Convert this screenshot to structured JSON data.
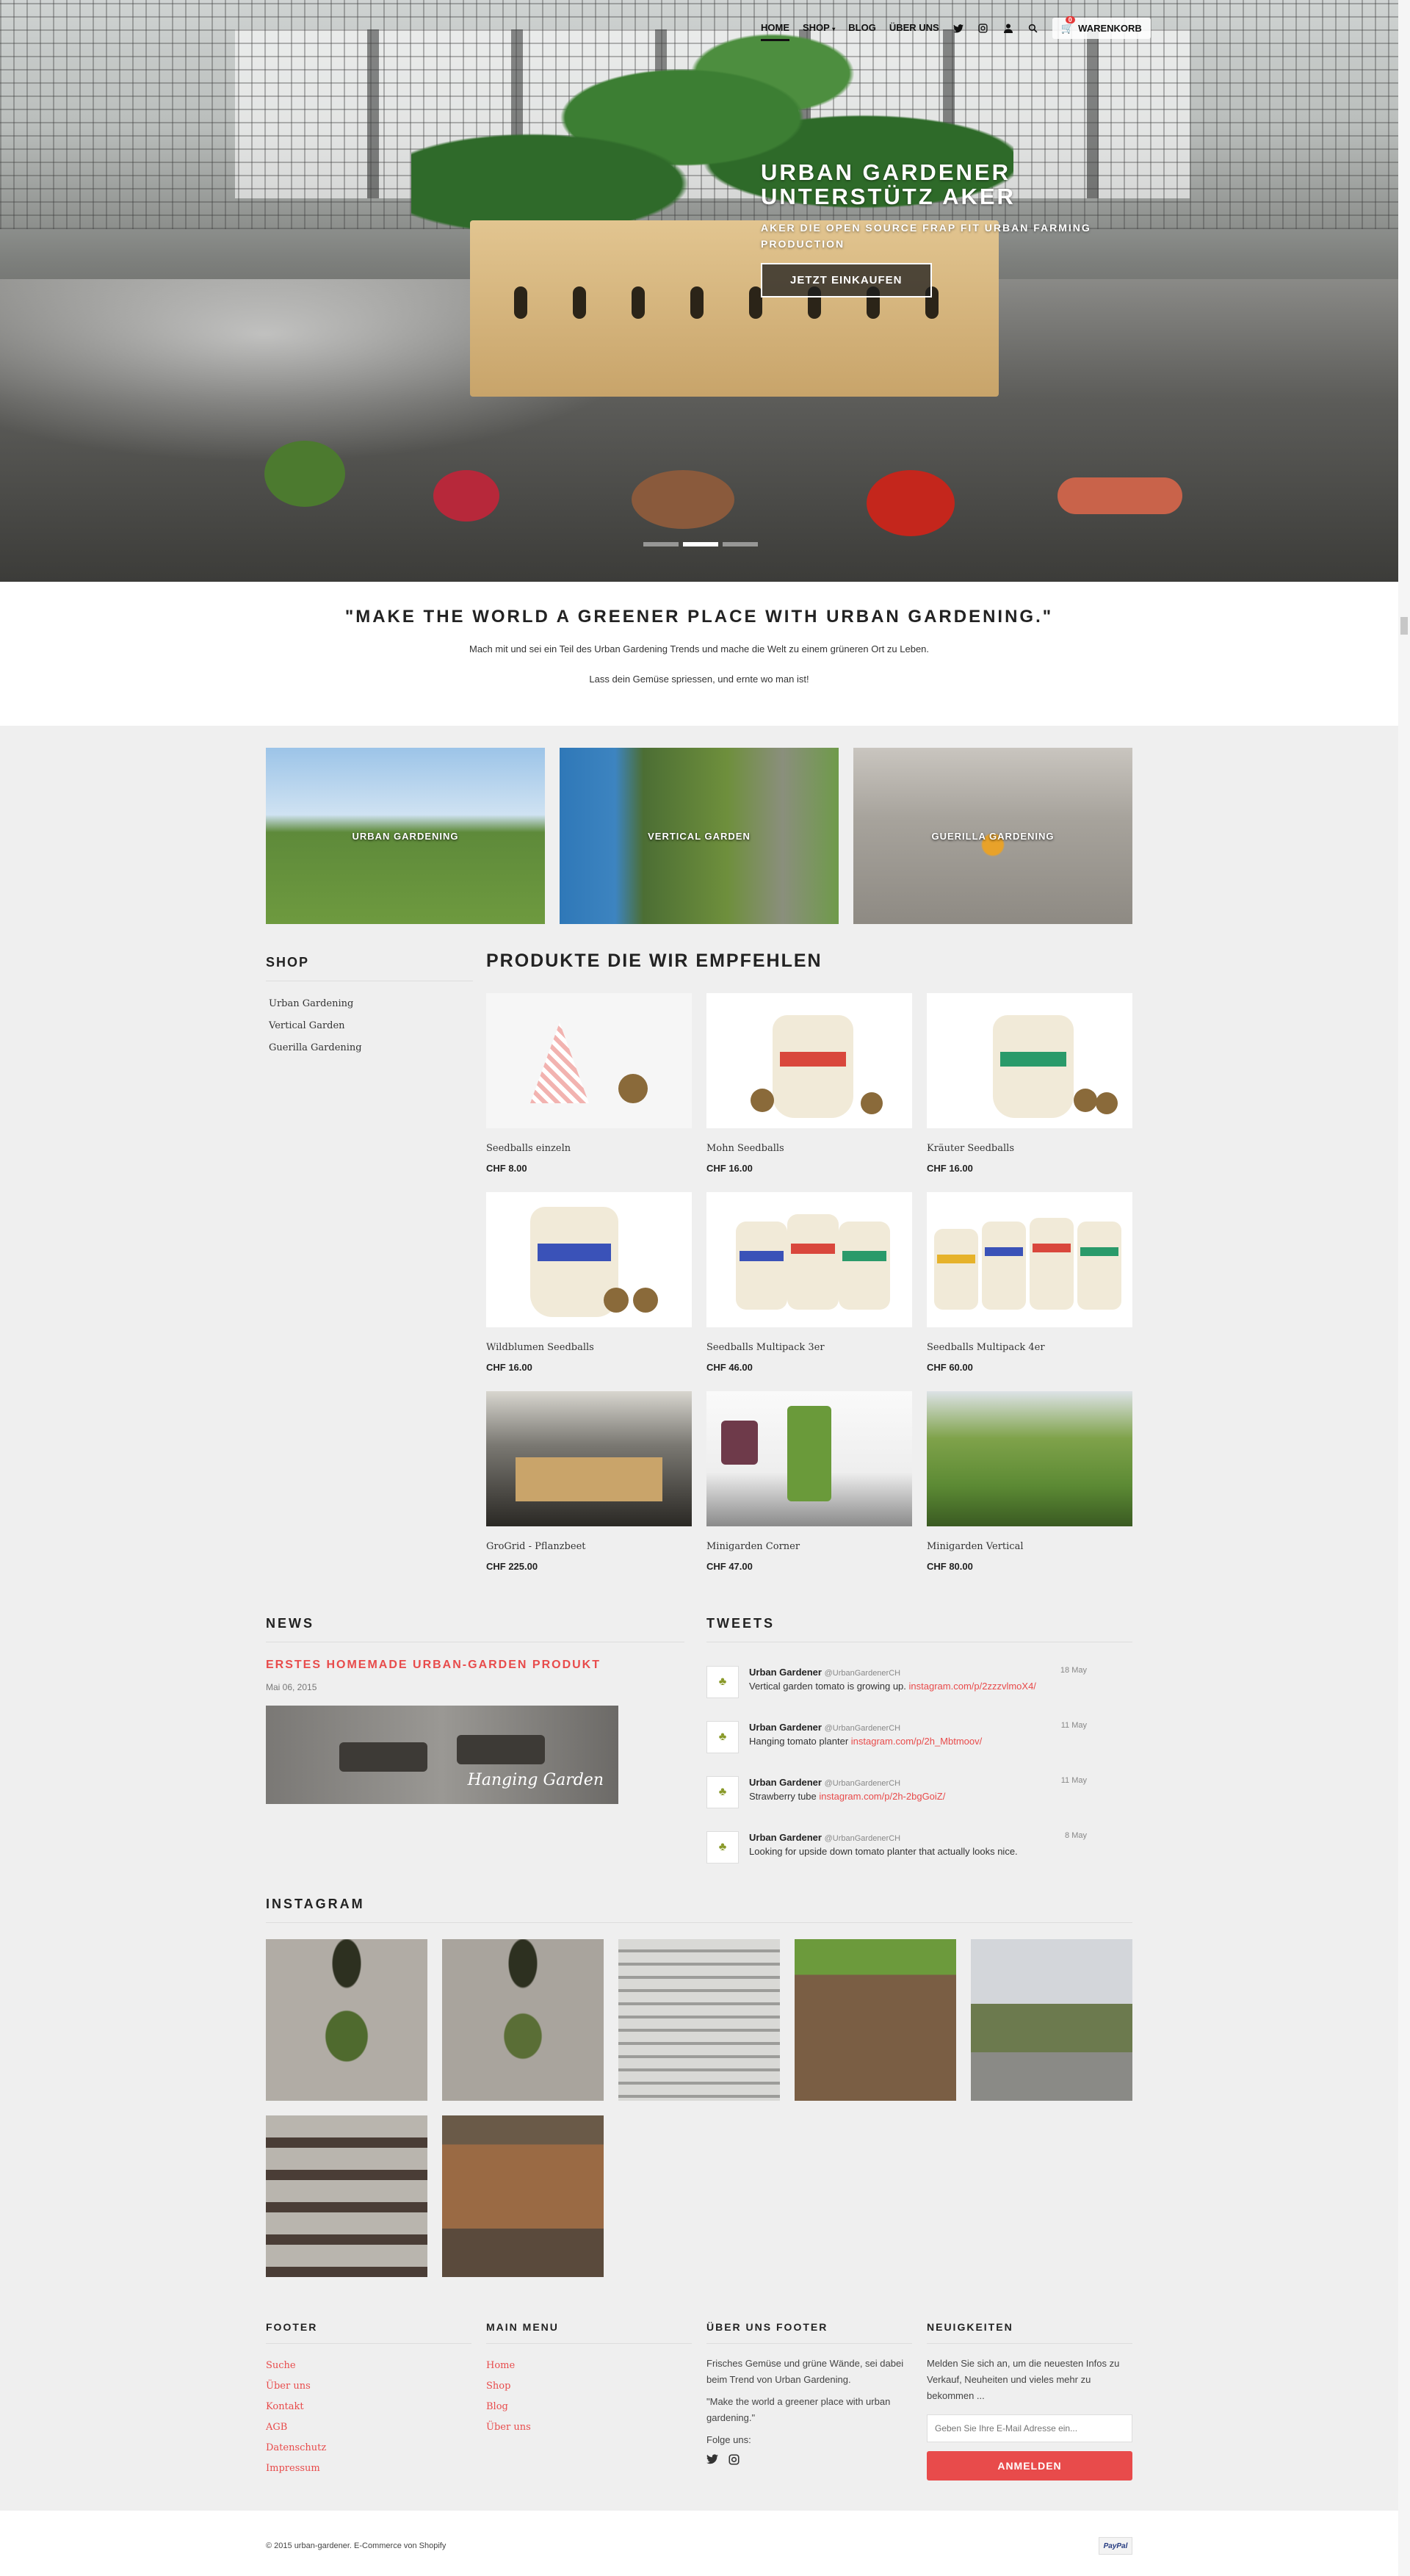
{
  "nav": {
    "home": "HOME",
    "shop": "SHOP",
    "blog": "BLOG",
    "about": "ÜBER UNS",
    "cart": "WARENKORB",
    "cart_count": "0"
  },
  "hero": {
    "title": "URBAN GARDENER UNTERSTÜTZ AKER",
    "subtitle": "AKER DIE OPEN SOURCE FRAP FIT URBAN FARMING PRODUCTION",
    "cta": "JETZT EINKAUFEN"
  },
  "quote": {
    "title": "\"MAKE THE WORLD A GREENER PLACE WITH URBAN GARDENING.\"",
    "line1": "Mach mit und sei ein Teil des Urban Gardening Trends und mache die Welt zu einem grüneren Ort zu Leben.",
    "line2": "Lass dein Gemüse spriessen, und ernte wo man ist!"
  },
  "categories": [
    "URBAN GARDENING",
    "VERTICAL GARDEN",
    "GUERILLA GARDENING"
  ],
  "shop_sidebar": {
    "title": "SHOP",
    "items": [
      "Urban Gardening",
      "Vertical Garden",
      "Guerilla Gardening"
    ]
  },
  "products_section": {
    "title": "PRODUKTE DIE WIR EMPFEHLEN",
    "items": [
      {
        "name": "Seedballs einzeln",
        "price": "CHF 8.00"
      },
      {
        "name": "Mohn Seedballs",
        "price": "CHF 16.00"
      },
      {
        "name": "Kräuter Seedballs",
        "price": "CHF 16.00"
      },
      {
        "name": "Wildblumen Seedballs",
        "price": "CHF 16.00"
      },
      {
        "name": "Seedballs Multipack 3er",
        "price": "CHF 46.00"
      },
      {
        "name": "Seedballs Multipack 4er",
        "price": "CHF 60.00"
      },
      {
        "name": "GroGrid - Pflanzbeet",
        "price": "CHF 225.00"
      },
      {
        "name": "Minigarden Corner",
        "price": "CHF 47.00"
      },
      {
        "name": "Minigarden Vertical",
        "price": "CHF 80.00"
      }
    ]
  },
  "news": {
    "title": "NEWS",
    "post_title": "ERSTES HOMEMADE URBAN-GARDEN PRODUKT",
    "date": "Mai 06, 2015",
    "image_caption": "Hanging Garden"
  },
  "tweets": {
    "title": "TWEETS",
    "items": [
      {
        "author": "Urban Gardener",
        "handle": "@UrbanGardenerCH",
        "date": "18 May",
        "text": "Vertical garden tomato is growing up.",
        "link": "instagram.com/p/2zzzvlmoX4/"
      },
      {
        "author": "Urban Gardener",
        "handle": "@UrbanGardenerCH",
        "date": "11 May",
        "text": "Hanging tomato planter",
        "link": "instagram.com/p/2h_Mbtmoov/"
      },
      {
        "author": "Urban Gardener",
        "handle": "@UrbanGardenerCH",
        "date": "11 May",
        "text": "Strawberry tube",
        "link": "instagram.com/p/2h-2bgGoiZ/"
      },
      {
        "author": "Urban Gardener",
        "handle": "@UrbanGardenerCH",
        "date": "8 May",
        "text": "Looking for upside down tomato planter that actually looks nice.",
        "link": ""
      }
    ]
  },
  "instagram": {
    "title": "INSTAGRAM"
  },
  "footer": {
    "col1_title": "FOOTER",
    "col1_links": [
      "Suche",
      "Über uns",
      "Kontakt",
      "AGB",
      "Datenschutz",
      "Impressum"
    ],
    "col2_title": "MAIN MENU",
    "col2_links": [
      "Home",
      "Shop",
      "Blog",
      "Über uns"
    ],
    "col3_title": "ÜBER UNS FOOTER",
    "col3_text1": "Frisches Gemüse und grüne Wände, sei dabei beim Trend von Urban Gardening.",
    "col3_text2": "\"Make the world a greener place with urban gardening.\"",
    "col3_follow": "Folge uns:",
    "col4_title": "NEUIGKEITEN",
    "col4_text": "Melden Sie sich an, um die neuesten Infos zu Verkauf, Neuheiten und vieles mehr zu bekommen ...",
    "email_placeholder": "Geben Sie Ihre E-Mail Adresse ein...",
    "subscribe": "ANMELDEN"
  },
  "bottom": {
    "copyright": "© 2015 urban-gardener. E-Commerce von Shopify",
    "paypal": "PayPal"
  },
  "colors": {
    "accent": "#e84b4b"
  }
}
